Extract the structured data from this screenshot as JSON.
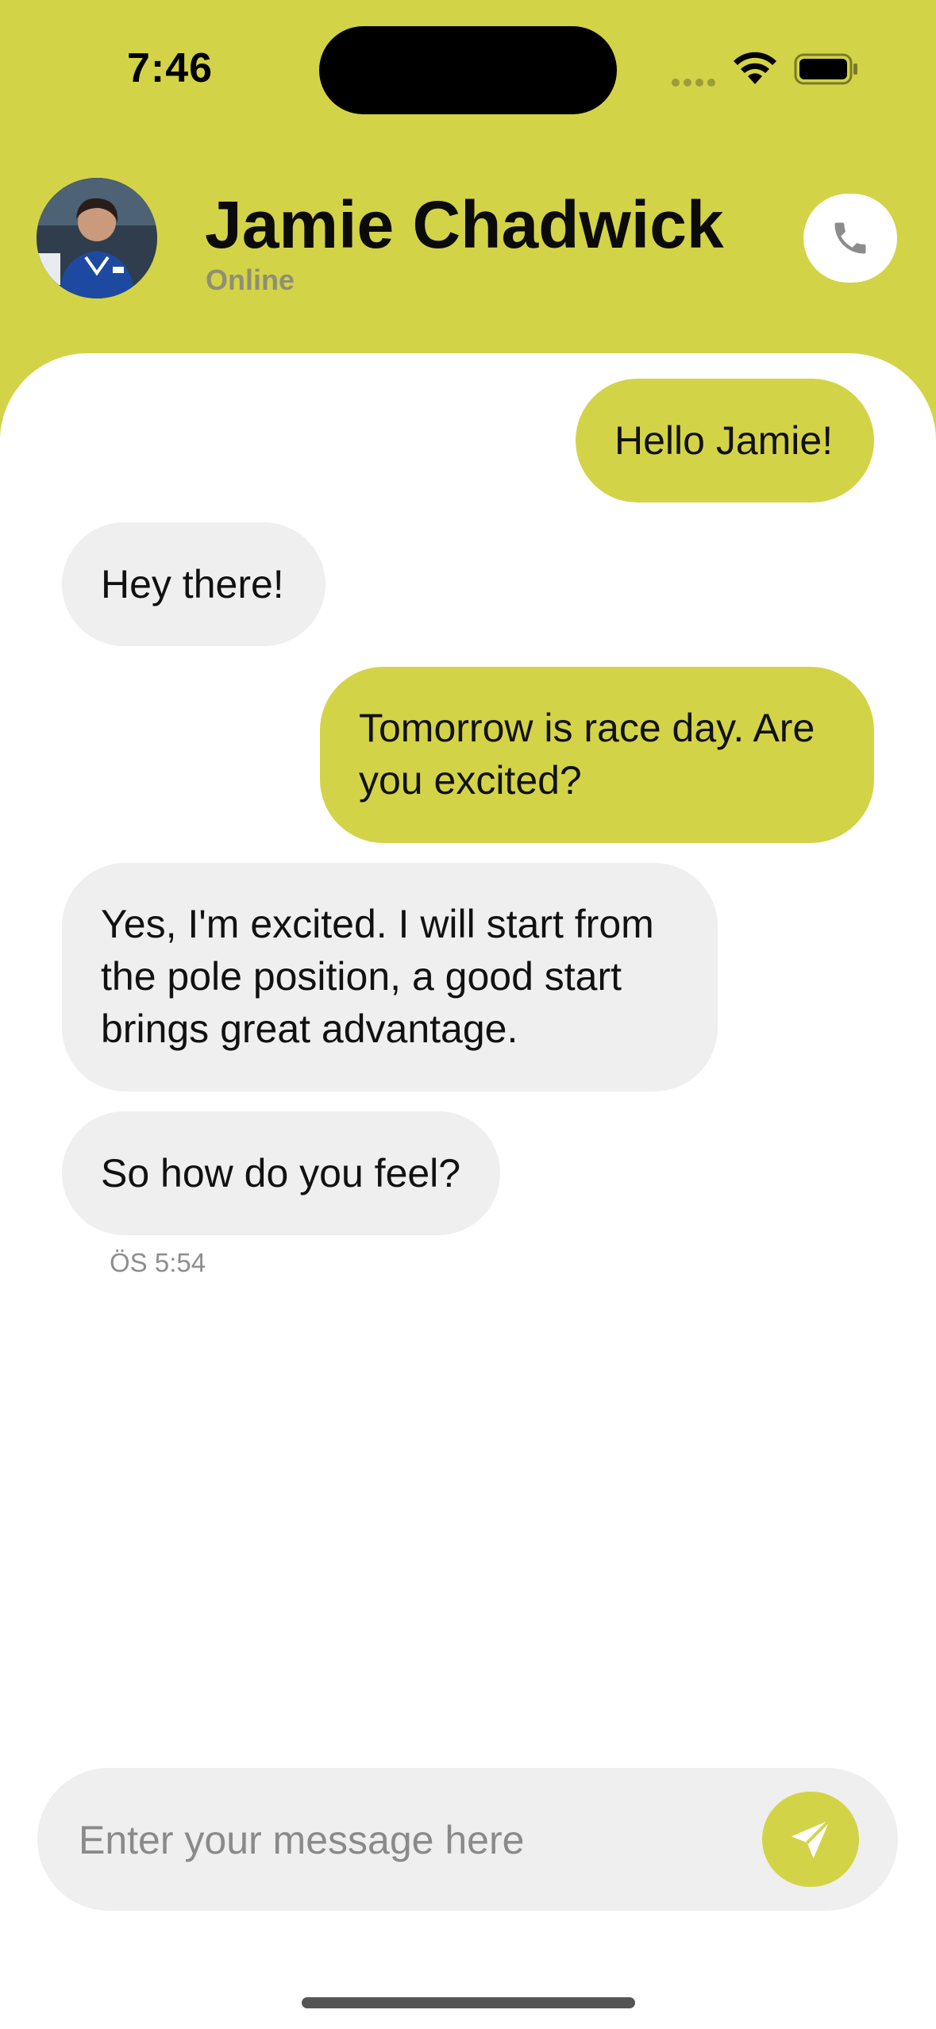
{
  "status_bar": {
    "time": "7:46"
  },
  "header": {
    "contact_name": "Jamie Chadwick",
    "contact_status": "Online",
    "call_icon": "phone-icon"
  },
  "messages": [
    {
      "side": "sent",
      "text": "Hello Jamie!"
    },
    {
      "side": "received",
      "text": "Hey there!"
    },
    {
      "side": "sent",
      "text": "Tomorrow is race day. Are you excited?"
    },
    {
      "side": "received",
      "text": "Yes, I'm excited. I will start from the pole position, a good start brings great advantage."
    },
    {
      "side": "received",
      "text": "So how do you feel?"
    }
  ],
  "last_message_time": "ÖS 5:54",
  "composer": {
    "placeholder": "Enter your message here",
    "value": "",
    "send_icon": "send-icon"
  },
  "colors": {
    "accent": "#d3d348",
    "received_bubble": "#efefef",
    "background": "#ffffff"
  }
}
